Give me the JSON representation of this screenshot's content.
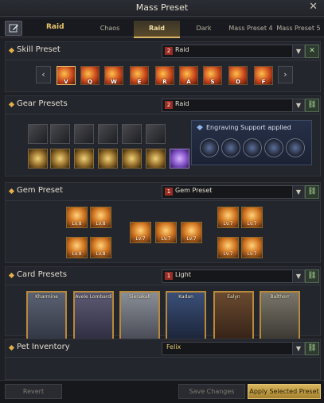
{
  "window": {
    "title": "Mass Preset",
    "close": "✕"
  },
  "tabs": {
    "active_label": "Raid",
    "items": [
      {
        "label": "Chaos"
      },
      {
        "label": "Raid"
      },
      {
        "label": "Dark"
      },
      {
        "label": "Mass Preset 4"
      },
      {
        "label": "Mass Preset 5"
      }
    ]
  },
  "skill_preset": {
    "title": "Skill Preset",
    "dropdown": {
      "number": "2",
      "value": "Raid"
    },
    "prev_icon": "chevron-left-icon",
    "next_icon": "chevron-right-icon",
    "skills": [
      {
        "key": "V"
      },
      {
        "key": "Q"
      },
      {
        "key": "W"
      },
      {
        "key": "E"
      },
      {
        "key": "R"
      },
      {
        "key": "A"
      },
      {
        "key": "S"
      },
      {
        "key": "D"
      },
      {
        "key": "F"
      }
    ]
  },
  "gear_presets": {
    "title": "Gear Presets",
    "dropdown": {
      "number": "2",
      "value": "Raid"
    },
    "engraving": {
      "label": "Engraving Support applied"
    }
  },
  "gem_preset": {
    "title": "Gem Preset",
    "dropdown": {
      "number": "1",
      "value": "Gem Preset"
    },
    "gems": [
      {
        "level": "Lv.8"
      },
      {
        "level": "Lv.8"
      },
      {
        "level": "Lv.8"
      },
      {
        "level": "Lv.8"
      },
      {
        "level": "Lv.7"
      },
      {
        "level": "Lv.7"
      },
      {
        "level": "Lv.7"
      },
      {
        "level": "Lv.7"
      },
      {
        "level": "Lv.7"
      },
      {
        "level": "Lv.7"
      },
      {
        "level": "Lv.7"
      }
    ]
  },
  "card_presets": {
    "title": "Card Presets",
    "dropdown": {
      "number": "1",
      "value": "Light"
    },
    "cards": [
      {
        "name": "Kharmine"
      },
      {
        "name": "Avele Lombardi"
      },
      {
        "name": "Sienakell"
      },
      {
        "name": "Kadan"
      },
      {
        "name": "Ealyn"
      },
      {
        "name": "Balthorr"
      }
    ],
    "stars": "●●●●●"
  },
  "pet_inventory": {
    "title": "Pet Inventory",
    "value": "Felix"
  },
  "footer": {
    "revert": "Revert",
    "save": "Save Changes",
    "apply": "Apply Selected Preset"
  },
  "colors": {
    "accent_gold": "#d9b565",
    "bg": "#1f2026"
  }
}
